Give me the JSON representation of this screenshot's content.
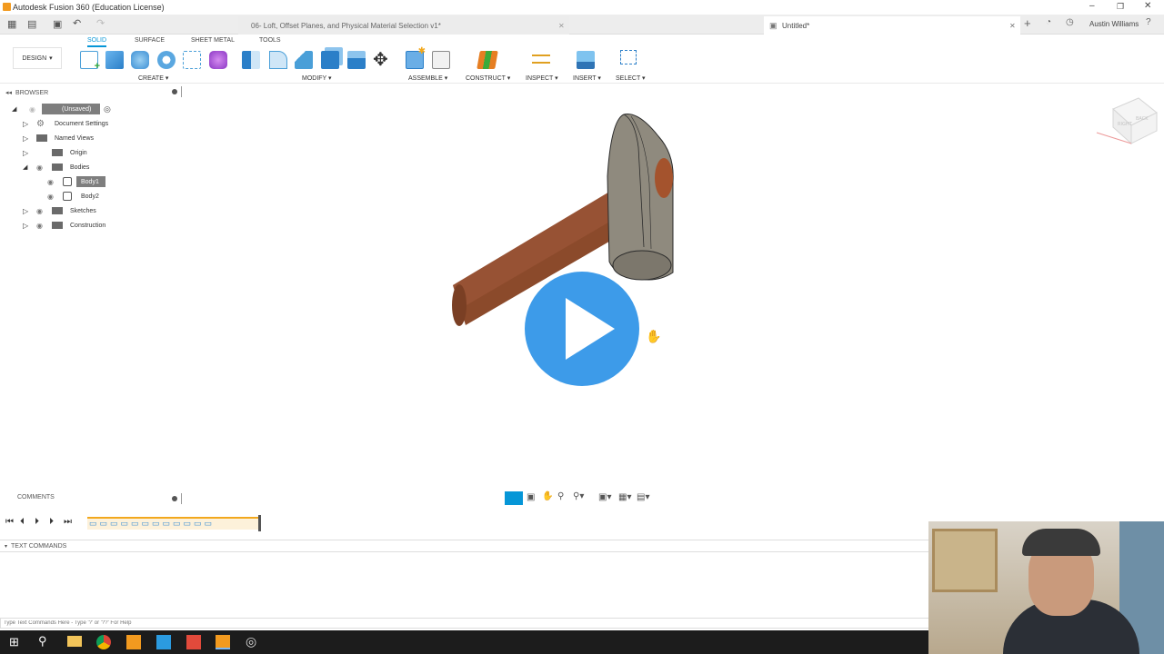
{
  "window": {
    "title": "Autodesk Fusion 360 (Education License)"
  },
  "tabs": [
    {
      "label": "06- Loft, Offset Planes, and Physical Material Selection v1*"
    },
    {
      "label": "Untitled*"
    }
  ],
  "user": {
    "name": "Austin Williams"
  },
  "toolbar": {
    "workspace": "DESIGN",
    "ws_tabs": [
      "SOLID",
      "SURFACE",
      "SHEET METAL",
      "TOOLS"
    ],
    "groups": [
      "CREATE",
      "MODIFY",
      "ASSEMBLE",
      "CONSTRUCT",
      "INSPECT",
      "INSERT",
      "SELECT"
    ]
  },
  "browser": {
    "title": "BROWSER",
    "root": "(Unsaved)",
    "items": [
      "Document Settings",
      "Named Views",
      "Origin",
      "Bodies",
      "Body1",
      "Body2",
      "Sketches",
      "Construction"
    ]
  },
  "comments": {
    "title": "COMMENTS"
  },
  "text_commands": {
    "title": "TEXT COMMANDS",
    "placeholder": "Type Text Commands Here - Type '?' or '??' For Help"
  },
  "viewcube": {
    "labels": [
      "RIGHT",
      "BACK"
    ]
  },
  "colors": {
    "accent": "#0696d7",
    "play": "#3d9be9",
    "handle": "#8b4a2b",
    "head": "#8a8578"
  }
}
